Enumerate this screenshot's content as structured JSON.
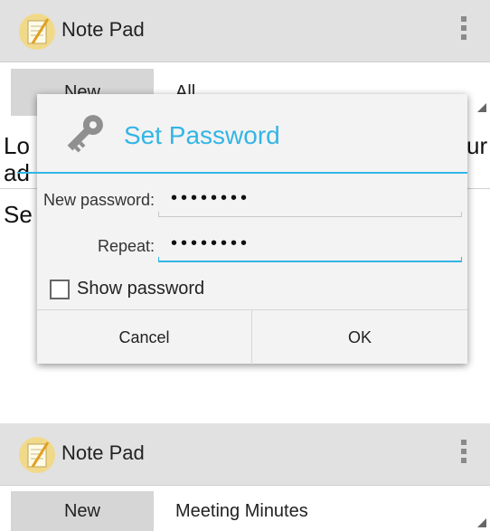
{
  "screen1": {
    "app_title": "Note Pad",
    "new_label": "New",
    "filter_value": "All",
    "bg_line1_left": "Lo",
    "bg_line1_right": "ur",
    "bg_line2_left": "ad",
    "bg_line3_left": "Se"
  },
  "dialog": {
    "title": "Set Password",
    "icon": "key-icon",
    "new_password_label": "New password:",
    "new_password_value": "••••••••",
    "repeat_label": "Repeat:",
    "repeat_value": "••••••••",
    "show_password_label": "Show password",
    "show_password_checked": false,
    "cancel_label": "Cancel",
    "ok_label": "OK"
  },
  "screen2": {
    "app_title": "Note Pad",
    "new_label": "New",
    "filter_value": "Meeting Minutes"
  },
  "colors": {
    "accent": "#33b5e5",
    "actionbar": "#e1e1e1",
    "new_button": "#d6d6d6"
  }
}
